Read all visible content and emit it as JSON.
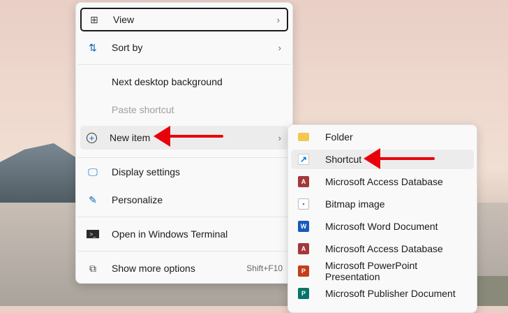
{
  "main_menu": {
    "items": [
      {
        "label": "View",
        "icon": "grid-icon",
        "has_submenu": true
      },
      {
        "label": "Sort by",
        "icon": "sort-icon",
        "has_submenu": true
      },
      {
        "label": "Next desktop background"
      },
      {
        "label": "Paste shortcut",
        "disabled": true
      },
      {
        "label": "New item",
        "icon": "plus-circle-icon",
        "has_submenu": true
      },
      {
        "label": "Display settings",
        "icon": "display-icon"
      },
      {
        "label": "Personalize",
        "icon": "brush-icon"
      },
      {
        "label": "Open in Windows Terminal",
        "icon": "terminal-icon"
      },
      {
        "label": "Show more options",
        "icon": "expand-icon",
        "shortcut": "Shift+F10"
      }
    ]
  },
  "sub_menu": {
    "items": [
      {
        "label": "Folder",
        "icon": "folder-icon"
      },
      {
        "label": "Shortcut",
        "icon": "shortcut-icon"
      },
      {
        "label": "Microsoft Access Database",
        "icon": "access-icon"
      },
      {
        "label": "Bitmap image",
        "icon": "bitmap-icon"
      },
      {
        "label": "Microsoft Word Document",
        "icon": "word-icon"
      },
      {
        "label": "Microsoft Access Database",
        "icon": "access-icon"
      },
      {
        "label": "Microsoft PowerPoint Presentation",
        "icon": "powerpoint-icon"
      },
      {
        "label": "Microsoft Publisher Document",
        "icon": "publisher-icon"
      }
    ]
  },
  "colors": {
    "annotation_arrow": "#e8000b",
    "accent": "#0067c0"
  }
}
